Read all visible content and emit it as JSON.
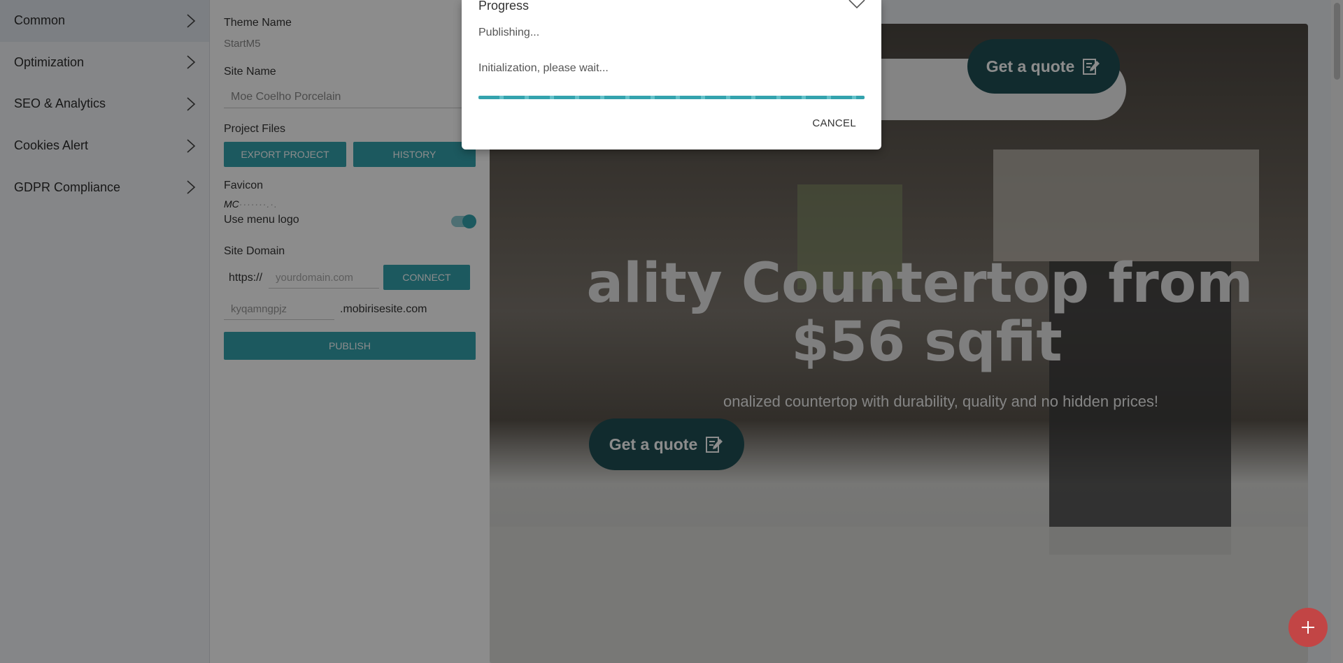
{
  "nav": {
    "items": [
      {
        "label": "Common"
      },
      {
        "label": "Optimization"
      },
      {
        "label": "SEO & Analytics"
      },
      {
        "label": "Cookies Alert"
      },
      {
        "label": "GDPR Compliance"
      }
    ]
  },
  "panel": {
    "theme_label": "Theme Name",
    "theme_value": "StartM5",
    "site_name_label": "Site Name",
    "site_name_value": "Moe Coelho Porcelain",
    "project_files_label": "Project Files",
    "export_button": "EXPORT PROJECT",
    "history_button": "HISTORY",
    "favicon_label": "Favicon",
    "favicon_text": "MC",
    "use_menu_logo_label": "Use menu logo",
    "use_menu_logo_on": true,
    "site_domain_label": "Site Domain",
    "protocol": "https://",
    "domain_placeholder": "yourdomain.com",
    "connect_button": "CONNECT",
    "subdomain_value": "kyqamngpjz",
    "subdomain_suffix": ".mobirisesite.com",
    "publish_button": "PUBLISH"
  },
  "preview": {
    "hero_title_line1": "ality Countertop from",
    "hero_title_line2": "$56 sqfit",
    "hero_subtitle": "onalized countertop with durability, quality and no hidden prices!",
    "quote_button": "Get a quote",
    "header_quote_button": "Get a quote"
  },
  "dialog": {
    "title": "Progress",
    "status": "Publishing...",
    "message": "Initialization, please wait...",
    "cancel": "CANCEL"
  },
  "colors": {
    "accent": "#34a3ae",
    "fab": "#c24545",
    "quote_button": "#1f4f54"
  },
  "fab_icon": "plus-icon"
}
